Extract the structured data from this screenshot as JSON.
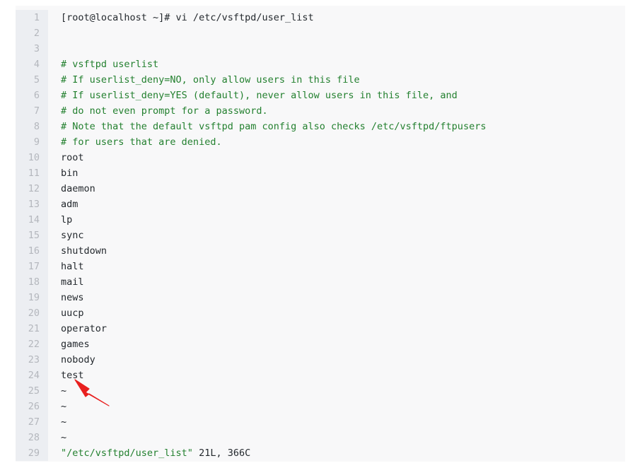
{
  "terminal": {
    "app": "vi-text-editor",
    "file_name": "/etc/vsftpd/user_list",
    "status_line": "\"/etc/vsftpd/user_list\" 21L, 366C",
    "colors": {
      "page_background": "#ffffff",
      "code_background": "#f8f8f9",
      "gutter_background": "#eceef2",
      "gutter_text": "#b4b7bd",
      "code_text": "#24292e",
      "comment_text": "#23802f",
      "annotation": "#e8201f"
    },
    "lines": [
      {
        "num": "1",
        "kind": "plain",
        "text": "[root@localhost ~]# vi /etc/vsftpd/user_list"
      },
      {
        "num": "2",
        "kind": "plain",
        "text": ""
      },
      {
        "num": "3",
        "kind": "plain",
        "text": ""
      },
      {
        "num": "4",
        "kind": "comment",
        "text": "# vsftpd userlist"
      },
      {
        "num": "5",
        "kind": "comment",
        "text": "# If userlist_deny=NO, only allow users in this file"
      },
      {
        "num": "6",
        "kind": "comment",
        "text": "# If userlist_deny=YES (default), never allow users in this file, and"
      },
      {
        "num": "7",
        "kind": "comment",
        "text": "# do not even prompt for a password."
      },
      {
        "num": "8",
        "kind": "comment",
        "text": "# Note that the default vsftpd pam config also checks /etc/vsftpd/ftpusers"
      },
      {
        "num": "9",
        "kind": "comment",
        "text": "# for users that are denied."
      },
      {
        "num": "10",
        "kind": "plain",
        "text": "root"
      },
      {
        "num": "11",
        "kind": "plain",
        "text": "bin"
      },
      {
        "num": "12",
        "kind": "plain",
        "text": "daemon"
      },
      {
        "num": "13",
        "kind": "plain",
        "text": "adm"
      },
      {
        "num": "14",
        "kind": "plain",
        "text": "lp"
      },
      {
        "num": "15",
        "kind": "plain",
        "text": "sync"
      },
      {
        "num": "16",
        "kind": "plain",
        "text": "shutdown"
      },
      {
        "num": "17",
        "kind": "plain",
        "text": "halt"
      },
      {
        "num": "18",
        "kind": "plain",
        "text": "mail"
      },
      {
        "num": "19",
        "kind": "plain",
        "text": "news"
      },
      {
        "num": "20",
        "kind": "plain",
        "text": "uucp"
      },
      {
        "num": "21",
        "kind": "plain",
        "text": "operator"
      },
      {
        "num": "22",
        "kind": "plain",
        "text": "games"
      },
      {
        "num": "23",
        "kind": "plain",
        "text": "nobody"
      },
      {
        "num": "24",
        "kind": "plain",
        "text": "test"
      },
      {
        "num": "25",
        "kind": "plain",
        "text": "~"
      },
      {
        "num": "26",
        "kind": "plain",
        "text": "~"
      },
      {
        "num": "27",
        "kind": "plain",
        "text": "~"
      },
      {
        "num": "28",
        "kind": "plain",
        "text": "~"
      },
      {
        "num": "29",
        "kind": "status",
        "text": "\"/etc/vsftpd/user_list\" 21L, 366C",
        "status_parts": {
          "quoted": "\"/etc/vsftpd/user_list\"",
          "counts": " 21L, 366C"
        }
      }
    ]
  },
  "annotation": {
    "type": "arrow",
    "color": "#e8201f",
    "points_to_line": "24",
    "points_to_text": "test"
  }
}
